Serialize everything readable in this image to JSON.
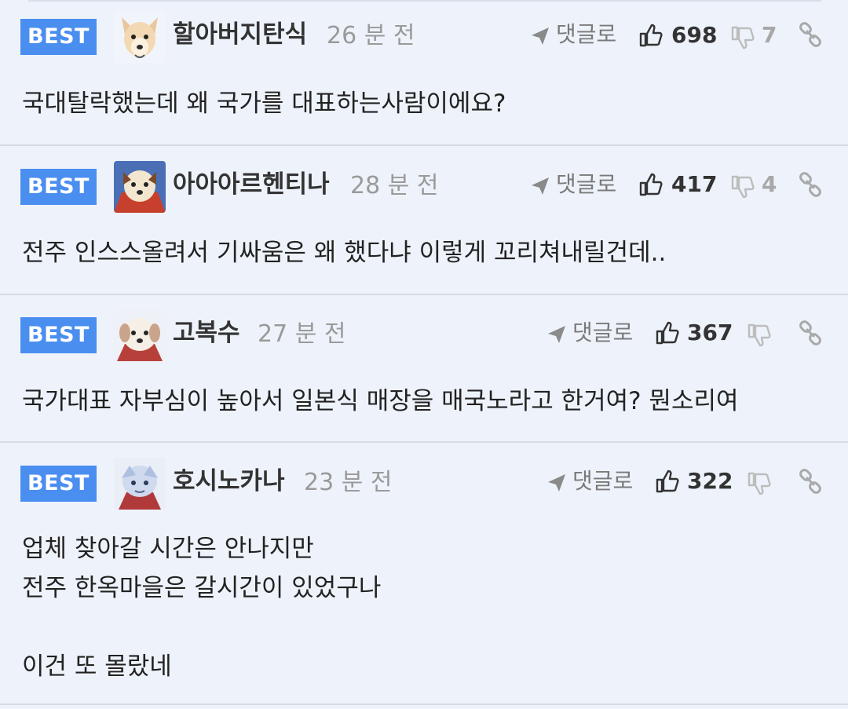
{
  "comments": [
    {
      "badge": "BEST",
      "nickname": "할아버지탄식",
      "time": "26 분 전",
      "reply_label": "댓글로",
      "likes": "698",
      "dislikes": "7",
      "text": "국대탈락했는데 왜 국가를 대표하는사람이에요?"
    },
    {
      "badge": "BEST",
      "nickname": "아아아르헨티나",
      "time": "28 분 전",
      "reply_label": "댓글로",
      "likes": "417",
      "dislikes": "4",
      "text": "전주 인스스올려서 기싸움은 왜 했다냐 이렇게 꼬리쳐내릴건데.."
    },
    {
      "badge": "BEST",
      "nickname": "고복수",
      "time": "27 분 전",
      "reply_label": "댓글로",
      "likes": "367",
      "dislikes": "",
      "text": "국가대표 자부심이 높아서 일본식 매장을 매국노라고 한거여? 뭔소리여"
    },
    {
      "badge": "BEST",
      "nickname": "호시노카나",
      "time": "23 분 전",
      "reply_label": "댓글로",
      "likes": "322",
      "dislikes": "",
      "text": "업체 찾아갈 시간은 안나지만\n전주 한옥마을은 갈시간이 있었구나\n\n이건 또 몰랐네"
    }
  ],
  "icons": {
    "reply": "reply-arrow-icon",
    "like": "thumbs-up-icon",
    "dislike": "thumbs-down-icon",
    "link": "link-icon"
  },
  "colors": {
    "badge": "#4a8ef0",
    "background": "#eef3fb",
    "divider": "#d6dbe3"
  }
}
